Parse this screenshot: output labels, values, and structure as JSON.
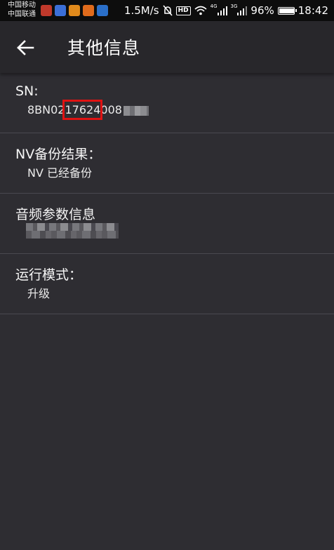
{
  "status_bar": {
    "carrier_1": "中国移动",
    "carrier_2": "中国联通",
    "speed": "1.5M/s",
    "hd": "HD",
    "net_4g": "4G",
    "net_3g": "3G",
    "battery": "96%",
    "battery_level": 0.96,
    "time": "18:42",
    "app_icon_colors": [
      "#c0392b",
      "#3b6fd8",
      "#e08a1c",
      "#e06b1c",
      "#2a6fc9"
    ]
  },
  "toolbar": {
    "title": "其他信息",
    "back_icon": "arrow-left-icon"
  },
  "items": [
    {
      "label": "SN:",
      "value_prefix": "8BN02",
      "value_highlight": "17624",
      "value_suffix": "008"
    },
    {
      "label": "NV备份结果：",
      "value": "NV 已经备份"
    },
    {
      "label": "音频参数信息",
      "value": ""
    },
    {
      "label": "运行模式：",
      "value": "升级"
    }
  ],
  "colors": {
    "background": "#2e2d32",
    "toolbar": "#28272b",
    "highlight_box": "#e01212"
  }
}
